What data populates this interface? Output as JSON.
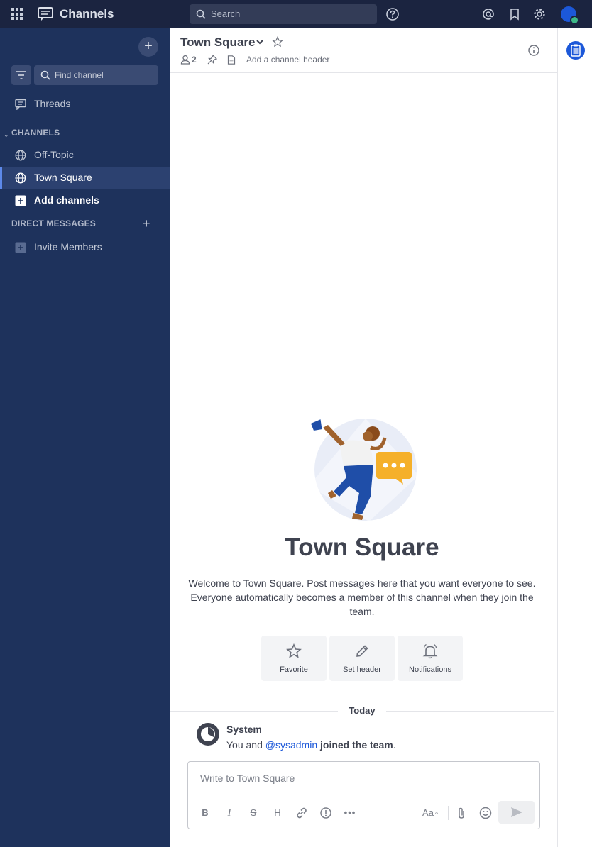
{
  "header": {
    "product_name": "Channels",
    "search_placeholder": "Search"
  },
  "sidebar": {
    "find_channel_placeholder": "Find channel",
    "threads_label": "Threads",
    "channels_section": "CHANNELS",
    "channels": [
      {
        "label": "Off-Topic",
        "active": false
      },
      {
        "label": "Town Square",
        "active": true
      }
    ],
    "add_channels_label": "Add channels",
    "dm_section": "DIRECT MESSAGES",
    "invite_label": "Invite Members"
  },
  "channel": {
    "name": "Town Square",
    "member_count": "2",
    "add_header_label": "Add a channel header",
    "intro_title": "Town Square",
    "intro_text": "Welcome to Town Square. Post messages here that you want everyone to see. Everyone automatically becomes a member of this channel when they join the team.",
    "actions": [
      {
        "label": "Favorite",
        "icon": "star-icon"
      },
      {
        "label": "Set header",
        "icon": "pencil-icon"
      },
      {
        "label": "Notifications",
        "icon": "bell-icon"
      }
    ]
  },
  "feed": {
    "date_separator": "Today",
    "messages": [
      {
        "author": "System",
        "text_prefix": "You and ",
        "mention": "@sysadmin",
        "text_bold": "joined the team",
        "text_suffix": "."
      }
    ]
  },
  "composer": {
    "placeholder": "Write to Town Square",
    "format_label": "Aa"
  },
  "colors": {
    "accent": "#1c58d9",
    "sidebar_bg": "#1e325c",
    "header_bg": "#1b2440",
    "online": "#3db887"
  }
}
